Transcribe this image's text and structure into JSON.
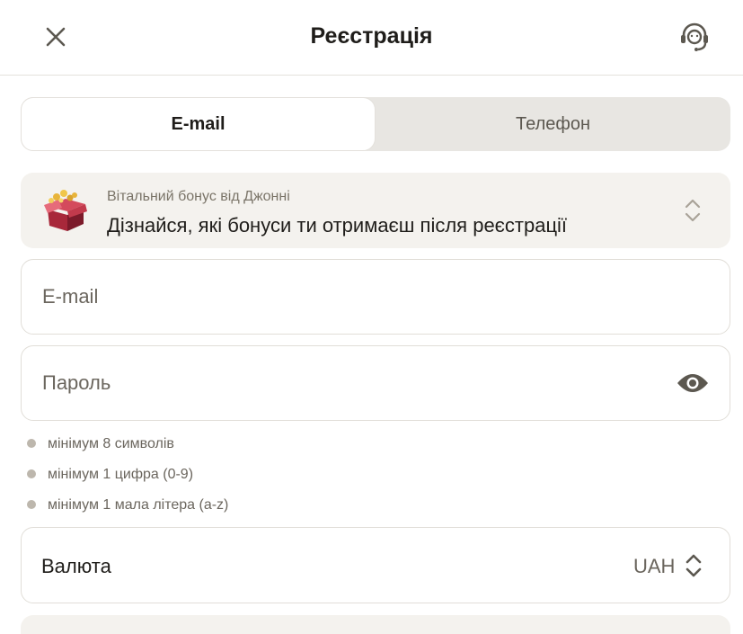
{
  "header": {
    "title": "Реєстрація",
    "close_icon": "close-icon",
    "support_icon": "headset-icon"
  },
  "tabs": [
    {
      "label": "E-mail",
      "active": true
    },
    {
      "label": "Телефон",
      "active": false
    }
  ],
  "bonus": {
    "subtitle": "Вітальний бонус від Джонні",
    "title": "Дізнайся, які бонуси ти отримаєш після реєстрації",
    "icon": "gift-box-icon"
  },
  "form": {
    "email": {
      "placeholder": "E-mail",
      "value": ""
    },
    "password": {
      "placeholder": "Пароль",
      "value": "",
      "toggle_icon": "eye-icon"
    },
    "rules": [
      "мінімум 8 символів",
      "мінімум 1 цифра (0-9)",
      "мінімум 1 мала літера (a-z)"
    ],
    "currency": {
      "label": "Валюта",
      "value": "UAH"
    }
  },
  "colors": {
    "text": "#1f1d1a",
    "muted": "#6b665e",
    "tab_bg": "#e8e6e2",
    "bonus_bg": "#f4f2ee",
    "border": "#e1ded8",
    "rule_dot": "#bdb7ad"
  }
}
